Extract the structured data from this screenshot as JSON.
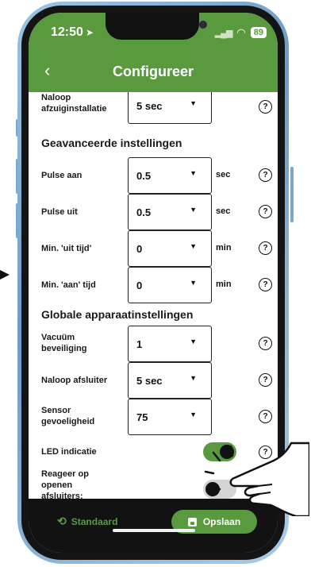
{
  "status": {
    "time": "12:50",
    "battery": "89"
  },
  "header": {
    "title": "Configureer"
  },
  "rows": {
    "naloop_afzuig": {
      "label": "Naloop afzuiginstallatie",
      "value": "5 sec"
    },
    "pulse_aan": {
      "label": "Pulse aan",
      "value": "0.5",
      "unit": "sec"
    },
    "pulse_uit": {
      "label": "Pulse uit",
      "value": "0.5",
      "unit": "sec"
    },
    "min_uit": {
      "label": "Min. 'uit tijd'",
      "value": "0",
      "unit": "min"
    },
    "min_aan": {
      "label": "Min. 'aan' tijd",
      "value": "0",
      "unit": "min"
    },
    "vacuum": {
      "label": "Vacuüm beveiliging",
      "value": "1"
    },
    "naloop_afsluiter": {
      "label": "Naloop afsluiter",
      "value": "5 sec"
    },
    "sensor": {
      "label": "Sensor gevoeligheid",
      "value": "75"
    },
    "led": {
      "label": "LED indicatie",
      "on": true
    },
    "reageer": {
      "label": "Reageer op openen afsluiters:",
      "on": false
    }
  },
  "sections": {
    "advanced": "Geavanceerde instellingen",
    "global": "Globale apparaatinstellingen"
  },
  "footer": {
    "standard_label": "Standaard",
    "save_label": "Opslaan"
  },
  "colors": {
    "accent": "#5a9a3f",
    "dark": "#121212"
  },
  "icons": [
    "back-icon",
    "location-arrow-icon",
    "signal-icon",
    "wifi-icon",
    "caret-down-icon",
    "help-icon",
    "reset-icon",
    "save-icon",
    "hand-pointer-icon"
  ]
}
